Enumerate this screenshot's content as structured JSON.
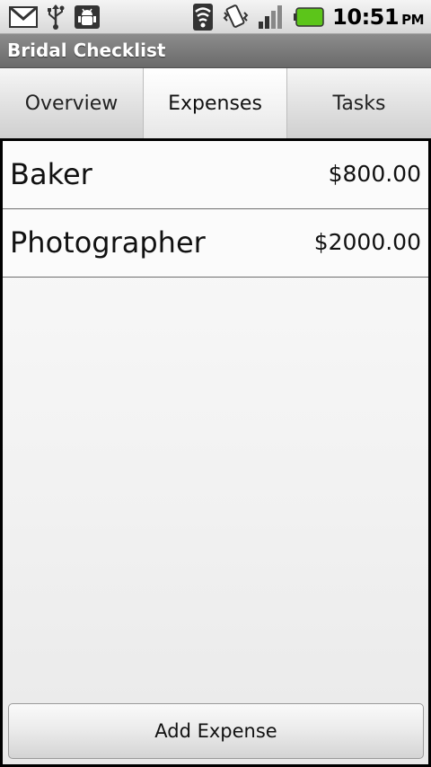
{
  "status_bar": {
    "icons_left": [
      "gmail-icon",
      "usb-icon",
      "android-debug-icon"
    ],
    "icons_right": [
      "wifi-icon",
      "vibrate-icon",
      "signal-icon",
      "battery-icon"
    ],
    "time": "10:51",
    "ampm": "PM",
    "battery_color": "#5cc51a"
  },
  "app": {
    "title": "Bridal Checklist"
  },
  "tabs": [
    {
      "label": "Overview",
      "selected": false
    },
    {
      "label": "Expenses",
      "selected": true
    },
    {
      "label": "Tasks",
      "selected": false
    }
  ],
  "expenses": [
    {
      "name": "Baker",
      "amount": "$800.00"
    },
    {
      "name": "Photographer",
      "amount": "$2000.00"
    }
  ],
  "actions": {
    "add_label": "Add Expense"
  }
}
